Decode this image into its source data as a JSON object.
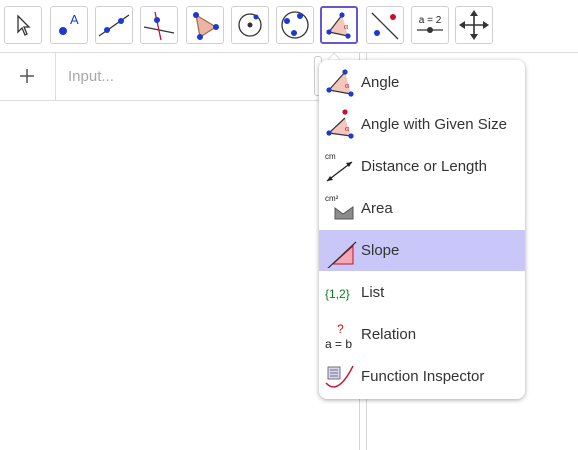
{
  "toolbar": {
    "tools": [
      {
        "name": "move"
      },
      {
        "name": "point"
      },
      {
        "name": "line"
      },
      {
        "name": "perpendicular-line"
      },
      {
        "name": "polygon"
      },
      {
        "name": "circle-center-point"
      },
      {
        "name": "circle-three-points"
      },
      {
        "name": "angle"
      },
      {
        "name": "reflect"
      },
      {
        "name": "slider"
      },
      {
        "name": "move-graphics-view"
      }
    ],
    "point_label": "A",
    "slider_label": "a = 2"
  },
  "algebra": {
    "plus_label": "+",
    "input_placeholder": "Input..."
  },
  "menu": {
    "items": [
      {
        "label": "Angle",
        "icon": "angle-icon"
      },
      {
        "label": "Angle with Given Size",
        "icon": "angle-given-size-icon"
      },
      {
        "label": "Distance or Length",
        "icon": "distance-icon",
        "icon_text": "cm"
      },
      {
        "label": "Area",
        "icon": "area-icon",
        "icon_text": "cm²"
      },
      {
        "label": "Slope",
        "icon": "slope-icon",
        "selected": true
      },
      {
        "label": "List",
        "icon": "list-icon",
        "icon_text": "{1,2}"
      },
      {
        "label": "Relation",
        "icon": "relation-icon",
        "icon_text": "a = b",
        "icon_question": "?"
      },
      {
        "label": "Function Inspector",
        "icon": "function-inspector-icon"
      }
    ]
  },
  "colors": {
    "active_tool_border": "#6557d2",
    "selected_item": "#c8c7f8",
    "point_blue": "#1b3ad0",
    "list_green": "#0a7d1a",
    "relation_red": "#d31010"
  }
}
